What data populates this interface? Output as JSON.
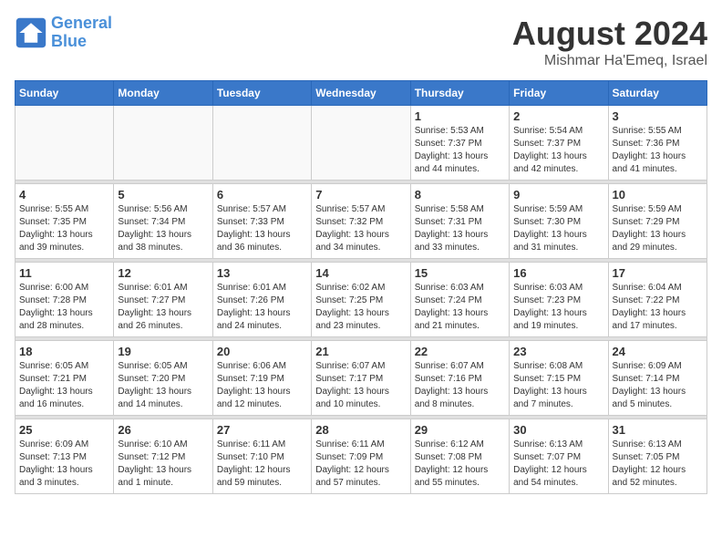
{
  "header": {
    "logo_line1": "General",
    "logo_line2": "Blue",
    "month": "August 2024",
    "location": "Mishmar Ha'Emeq, Israel"
  },
  "weekdays": [
    "Sunday",
    "Monday",
    "Tuesday",
    "Wednesday",
    "Thursday",
    "Friday",
    "Saturday"
  ],
  "weeks": [
    [
      {
        "day": "",
        "info": ""
      },
      {
        "day": "",
        "info": ""
      },
      {
        "day": "",
        "info": ""
      },
      {
        "day": "",
        "info": ""
      },
      {
        "day": "1",
        "info": "Sunrise: 5:53 AM\nSunset: 7:37 PM\nDaylight: 13 hours\nand 44 minutes."
      },
      {
        "day": "2",
        "info": "Sunrise: 5:54 AM\nSunset: 7:37 PM\nDaylight: 13 hours\nand 42 minutes."
      },
      {
        "day": "3",
        "info": "Sunrise: 5:55 AM\nSunset: 7:36 PM\nDaylight: 13 hours\nand 41 minutes."
      }
    ],
    [
      {
        "day": "4",
        "info": "Sunrise: 5:55 AM\nSunset: 7:35 PM\nDaylight: 13 hours\nand 39 minutes."
      },
      {
        "day": "5",
        "info": "Sunrise: 5:56 AM\nSunset: 7:34 PM\nDaylight: 13 hours\nand 38 minutes."
      },
      {
        "day": "6",
        "info": "Sunrise: 5:57 AM\nSunset: 7:33 PM\nDaylight: 13 hours\nand 36 minutes."
      },
      {
        "day": "7",
        "info": "Sunrise: 5:57 AM\nSunset: 7:32 PM\nDaylight: 13 hours\nand 34 minutes."
      },
      {
        "day": "8",
        "info": "Sunrise: 5:58 AM\nSunset: 7:31 PM\nDaylight: 13 hours\nand 33 minutes."
      },
      {
        "day": "9",
        "info": "Sunrise: 5:59 AM\nSunset: 7:30 PM\nDaylight: 13 hours\nand 31 minutes."
      },
      {
        "day": "10",
        "info": "Sunrise: 5:59 AM\nSunset: 7:29 PM\nDaylight: 13 hours\nand 29 minutes."
      }
    ],
    [
      {
        "day": "11",
        "info": "Sunrise: 6:00 AM\nSunset: 7:28 PM\nDaylight: 13 hours\nand 28 minutes."
      },
      {
        "day": "12",
        "info": "Sunrise: 6:01 AM\nSunset: 7:27 PM\nDaylight: 13 hours\nand 26 minutes."
      },
      {
        "day": "13",
        "info": "Sunrise: 6:01 AM\nSunset: 7:26 PM\nDaylight: 13 hours\nand 24 minutes."
      },
      {
        "day": "14",
        "info": "Sunrise: 6:02 AM\nSunset: 7:25 PM\nDaylight: 13 hours\nand 23 minutes."
      },
      {
        "day": "15",
        "info": "Sunrise: 6:03 AM\nSunset: 7:24 PM\nDaylight: 13 hours\nand 21 minutes."
      },
      {
        "day": "16",
        "info": "Sunrise: 6:03 AM\nSunset: 7:23 PM\nDaylight: 13 hours\nand 19 minutes."
      },
      {
        "day": "17",
        "info": "Sunrise: 6:04 AM\nSunset: 7:22 PM\nDaylight: 13 hours\nand 17 minutes."
      }
    ],
    [
      {
        "day": "18",
        "info": "Sunrise: 6:05 AM\nSunset: 7:21 PM\nDaylight: 13 hours\nand 16 minutes."
      },
      {
        "day": "19",
        "info": "Sunrise: 6:05 AM\nSunset: 7:20 PM\nDaylight: 13 hours\nand 14 minutes."
      },
      {
        "day": "20",
        "info": "Sunrise: 6:06 AM\nSunset: 7:19 PM\nDaylight: 13 hours\nand 12 minutes."
      },
      {
        "day": "21",
        "info": "Sunrise: 6:07 AM\nSunset: 7:17 PM\nDaylight: 13 hours\nand 10 minutes."
      },
      {
        "day": "22",
        "info": "Sunrise: 6:07 AM\nSunset: 7:16 PM\nDaylight: 13 hours\nand 8 minutes."
      },
      {
        "day": "23",
        "info": "Sunrise: 6:08 AM\nSunset: 7:15 PM\nDaylight: 13 hours\nand 7 minutes."
      },
      {
        "day": "24",
        "info": "Sunrise: 6:09 AM\nSunset: 7:14 PM\nDaylight: 13 hours\nand 5 minutes."
      }
    ],
    [
      {
        "day": "25",
        "info": "Sunrise: 6:09 AM\nSunset: 7:13 PM\nDaylight: 13 hours\nand 3 minutes."
      },
      {
        "day": "26",
        "info": "Sunrise: 6:10 AM\nSunset: 7:12 PM\nDaylight: 13 hours\nand 1 minute."
      },
      {
        "day": "27",
        "info": "Sunrise: 6:11 AM\nSunset: 7:10 PM\nDaylight: 12 hours\nand 59 minutes."
      },
      {
        "day": "28",
        "info": "Sunrise: 6:11 AM\nSunset: 7:09 PM\nDaylight: 12 hours\nand 57 minutes."
      },
      {
        "day": "29",
        "info": "Sunrise: 6:12 AM\nSunset: 7:08 PM\nDaylight: 12 hours\nand 55 minutes."
      },
      {
        "day": "30",
        "info": "Sunrise: 6:13 AM\nSunset: 7:07 PM\nDaylight: 12 hours\nand 54 minutes."
      },
      {
        "day": "31",
        "info": "Sunrise: 6:13 AM\nSunset: 7:05 PM\nDaylight: 12 hours\nand 52 minutes."
      }
    ]
  ]
}
